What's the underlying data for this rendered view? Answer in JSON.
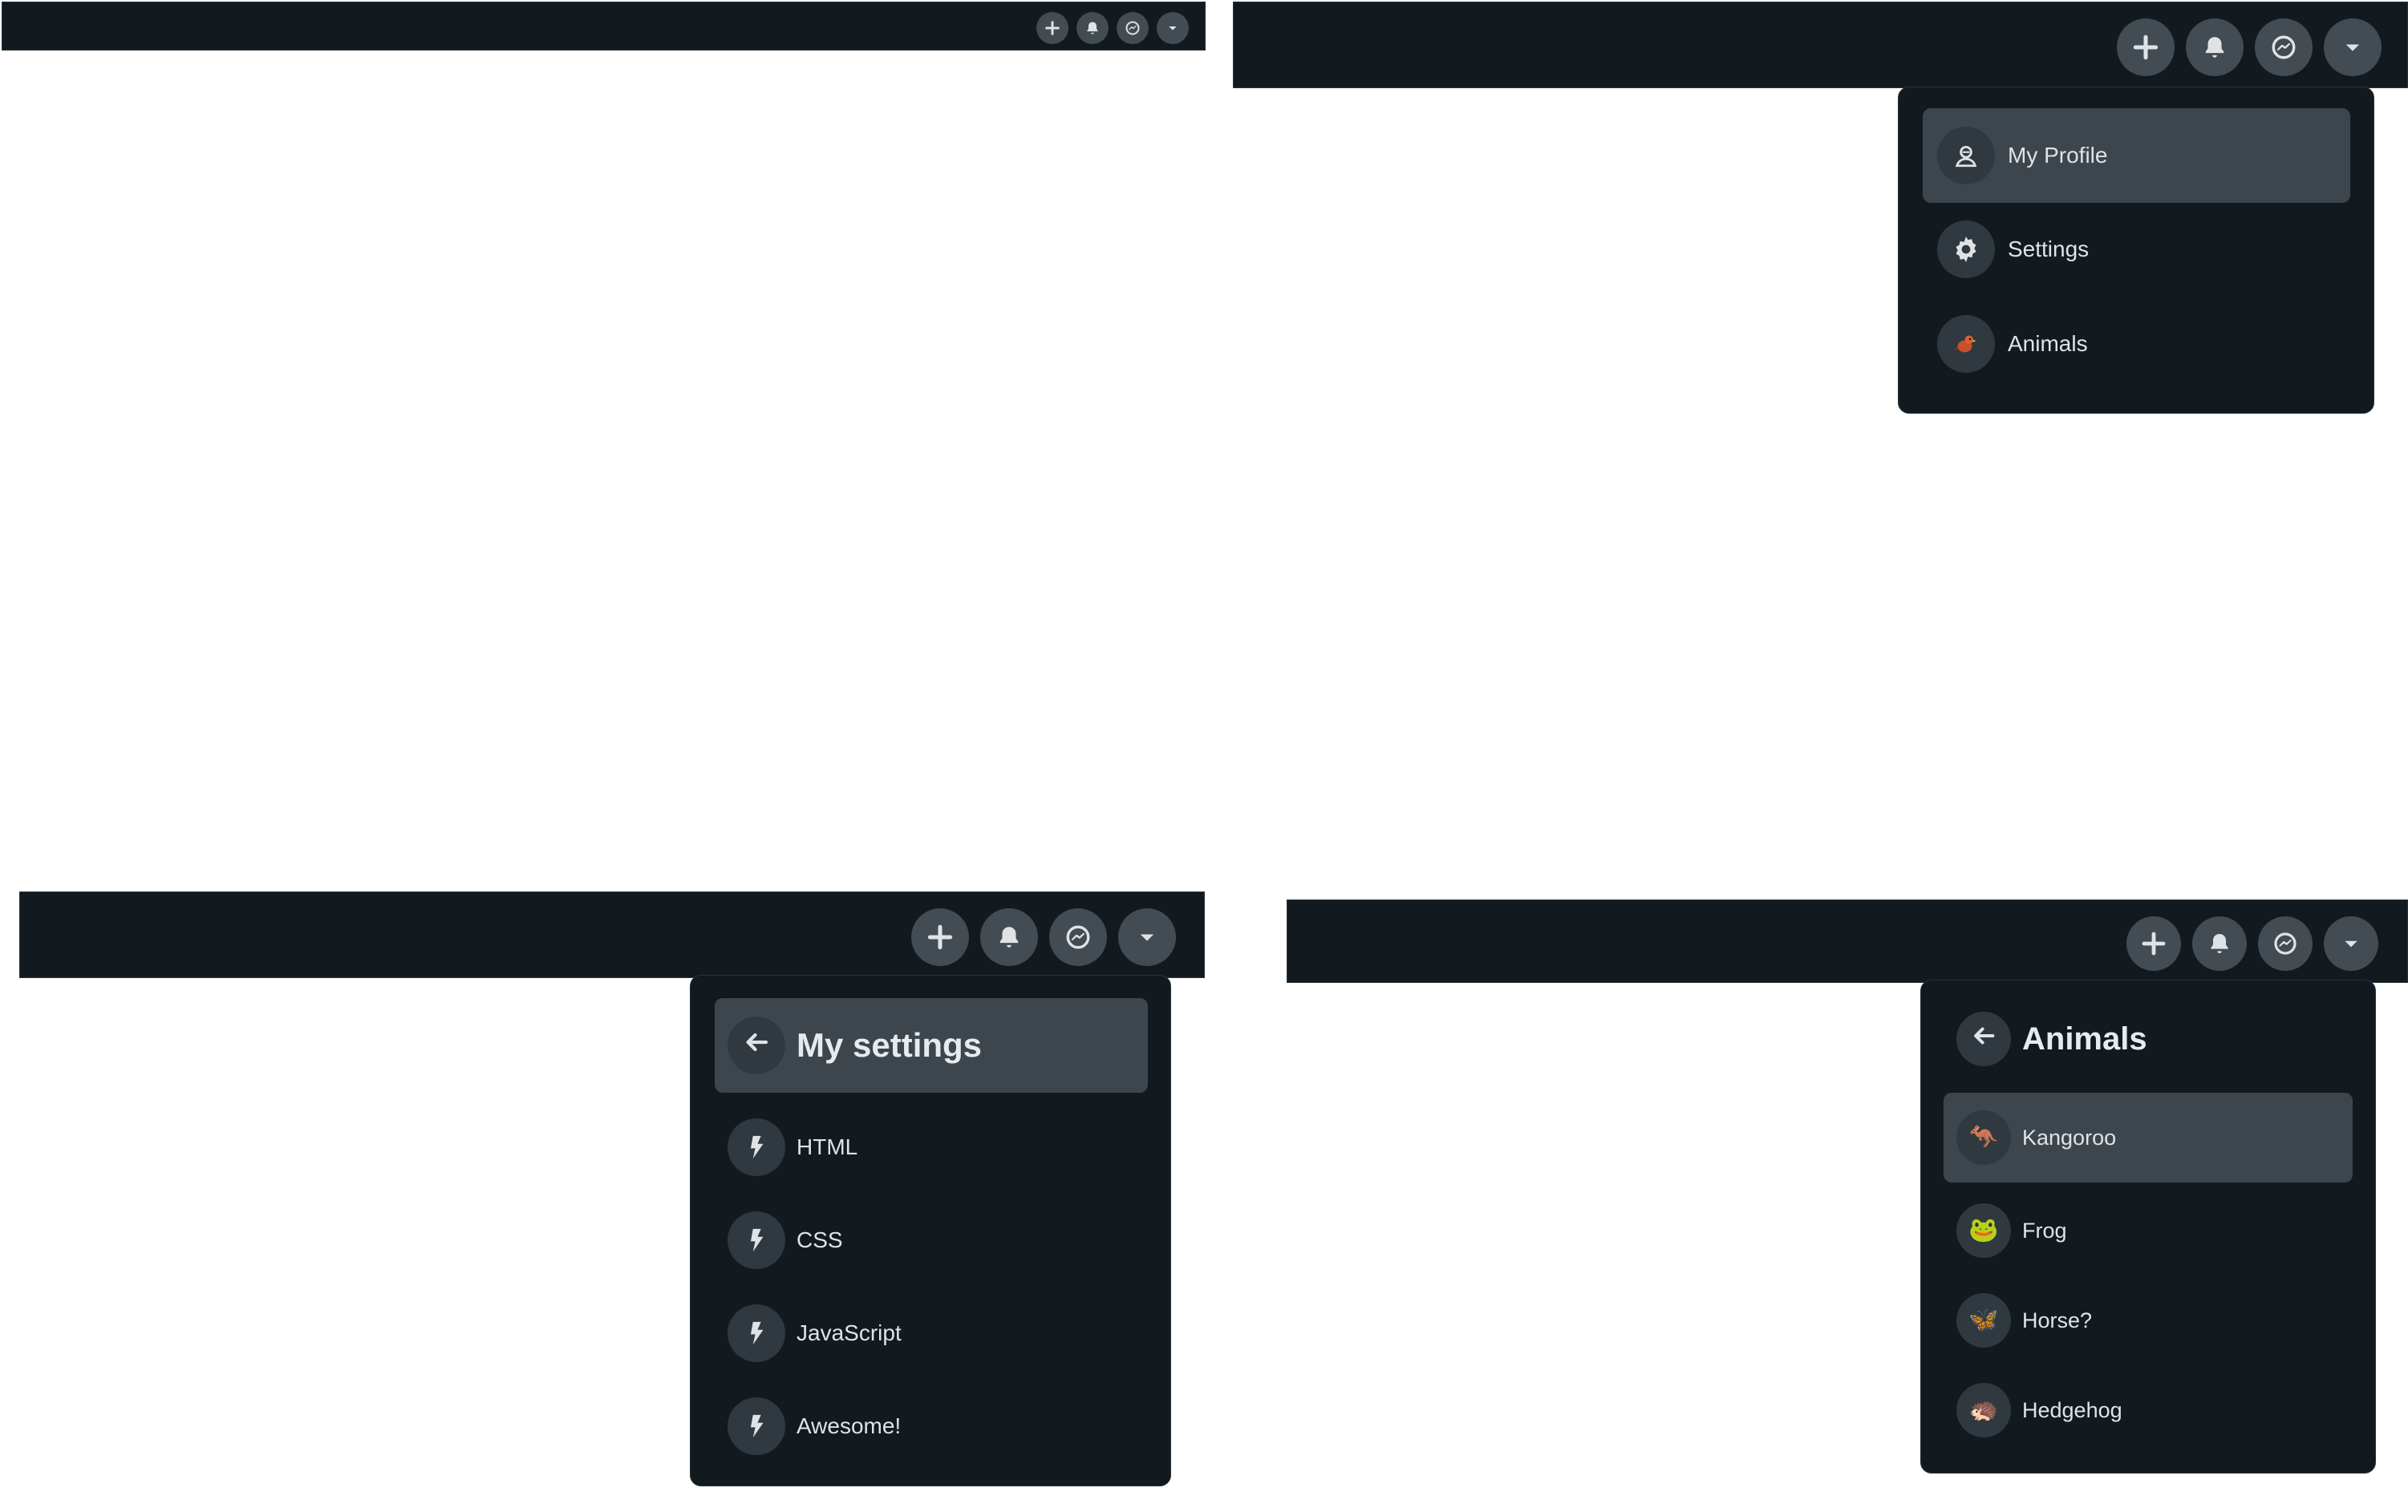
{
  "navbar": {
    "buttons": [
      {
        "name": "plus-icon",
        "label": "New"
      },
      {
        "name": "bell-icon",
        "label": "Notifications"
      },
      {
        "name": "messenger-icon",
        "label": "Messenger"
      },
      {
        "name": "caret-down-icon",
        "label": "Menu"
      }
    ]
  },
  "main_menu": {
    "items": [
      {
        "label": "My Profile",
        "icon": "user-icon"
      },
      {
        "label": "Settings",
        "icon": "gear-icon"
      },
      {
        "label": "Animals",
        "icon": "bird-icon"
      }
    ]
  },
  "settings_menu": {
    "title": "My settings",
    "back_icon": "arrow-left-icon",
    "items": [
      {
        "label": "HTML",
        "icon": "bolt-icon"
      },
      {
        "label": "CSS",
        "icon": "bolt-icon"
      },
      {
        "label": "JavaScript",
        "icon": "bolt-icon"
      },
      {
        "label": "Awesome!",
        "icon": "bolt-icon"
      }
    ]
  },
  "animals_menu": {
    "title": "Animals",
    "back_icon": "arrow-left-icon",
    "items": [
      {
        "label": "Kangoroo",
        "emoji": "🦘"
      },
      {
        "label": "Frog",
        "emoji": "🐸"
      },
      {
        "label": "Horse?",
        "emoji": "🦋"
      },
      {
        "label": "Hedgehog",
        "emoji": "🦔"
      }
    ]
  },
  "colors": {
    "navbar_bg": "#121a1f",
    "button_bg": "#434c52",
    "icon_circle_bg": "#30393f",
    "active_item_bg": "#3d464c",
    "text": "#dfe3e6"
  }
}
